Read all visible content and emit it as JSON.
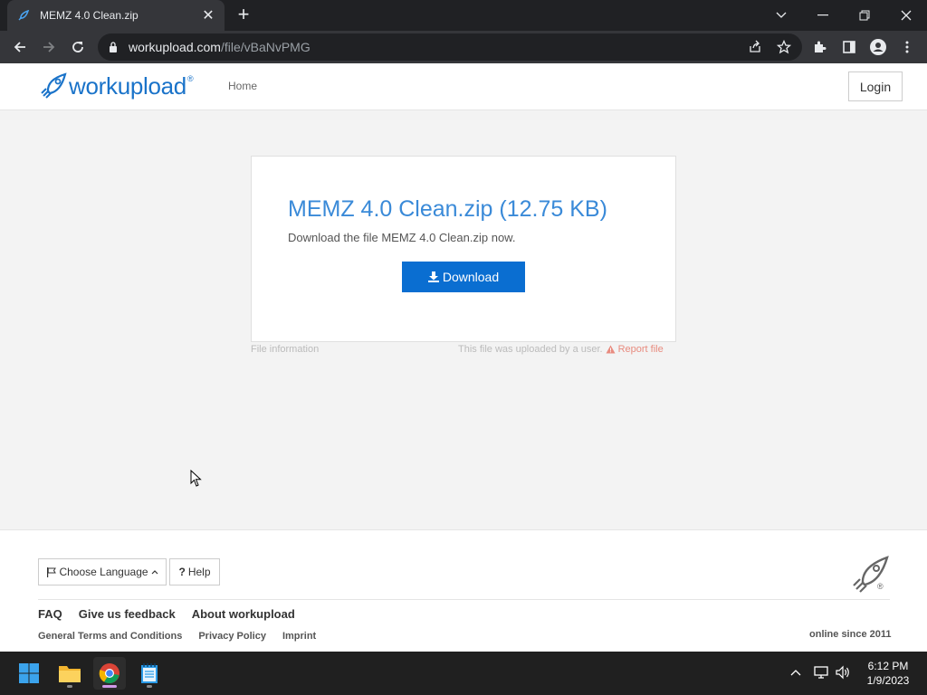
{
  "browser": {
    "tab_title": "MEMZ 4.0 Clean.zip",
    "tab_close": "✕",
    "new_tab": "+",
    "url_host": "workupload.com",
    "url_path": "/file/vBaNvPMG"
  },
  "header": {
    "logo_text": "workupload",
    "logo_reg": "®",
    "nav_home": "Home",
    "login_label": "Login"
  },
  "file": {
    "title": "MEMZ 4.0 Clean.zip (12.75 KB)",
    "description": "Download the file MEMZ 4.0 Clean.zip now.",
    "download_label": "Download",
    "info_label": "File information",
    "upload_note": "This file was uploaded by a user.",
    "report_label": "Report file"
  },
  "footer": {
    "language_label": "Choose Language",
    "help_label": "Help",
    "links": [
      "FAQ",
      "Give us feedback",
      "About workupload"
    ],
    "sublinks": [
      "General Terms and Conditions",
      "Privacy Policy",
      "Imprint"
    ],
    "online_since": "online since 2011",
    "rocket_reg": "®"
  },
  "taskbar": {
    "time": "6:12 PM",
    "date": "1/9/2023"
  },
  "colors": {
    "brand": "#1a73c9",
    "download_button": "#0a6ed1",
    "report": "#e88b7f"
  }
}
